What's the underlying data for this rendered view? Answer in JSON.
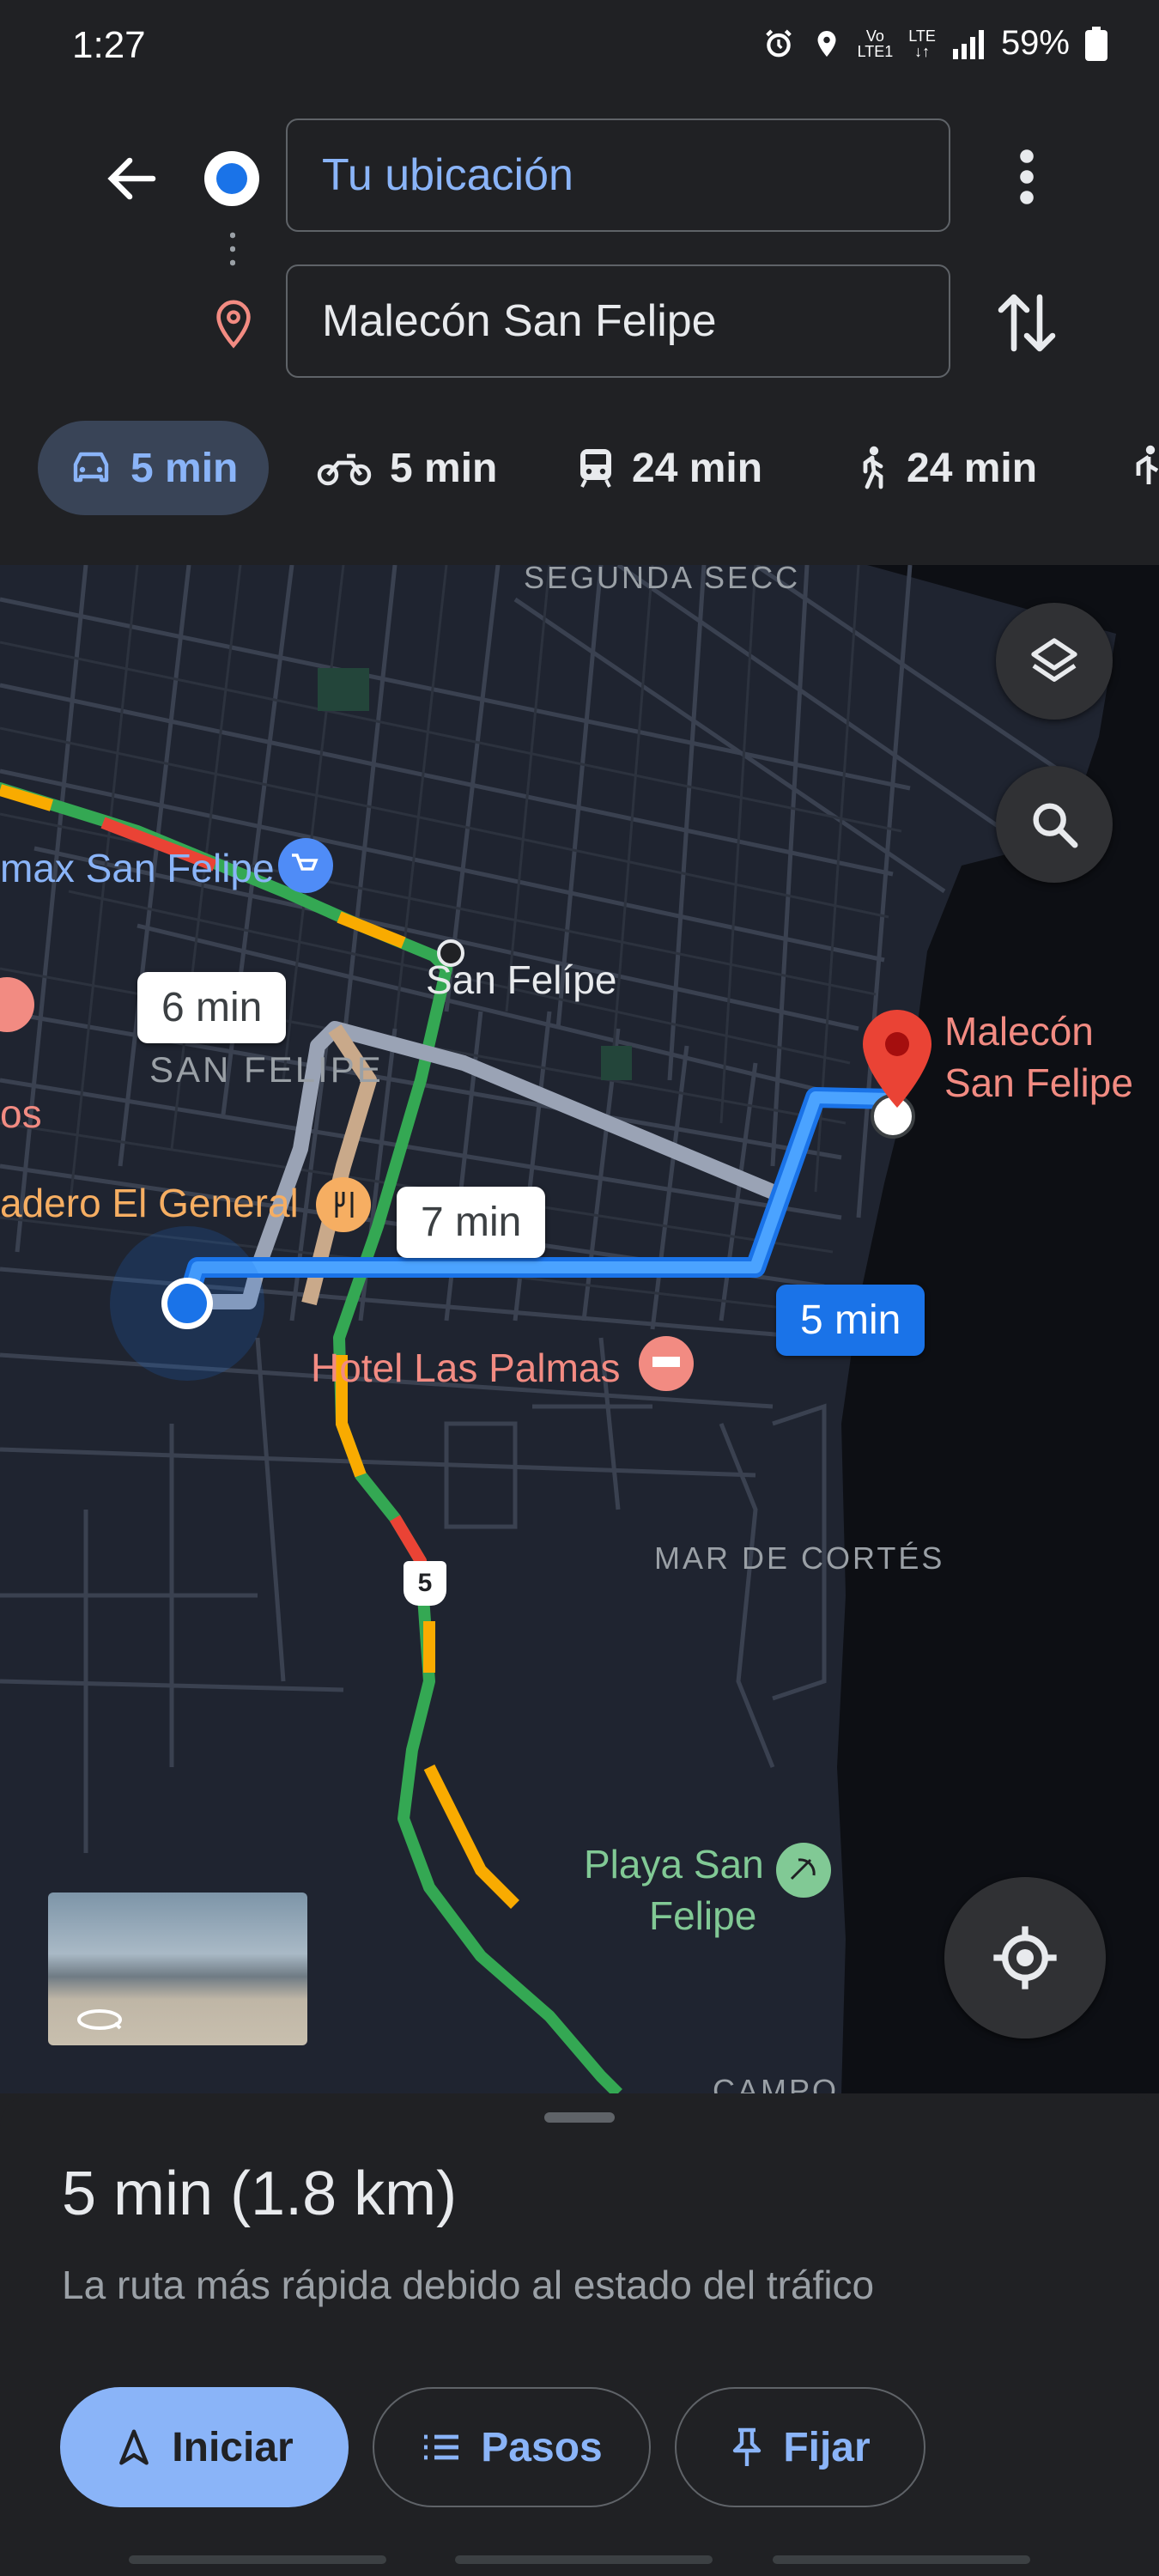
{
  "status_bar": {
    "time": "1:27",
    "network_top": "Vo",
    "network_bottom": "LTE1",
    "lte_label": "LTE",
    "battery": "59%",
    "icons": [
      "alarm-icon",
      "location-icon",
      "signal-icon",
      "battery-icon"
    ]
  },
  "directions": {
    "origin": "Tu ubicación",
    "destination": "Malecón San Felipe"
  },
  "modes": [
    {
      "name": "car",
      "time": "5 min",
      "selected": true
    },
    {
      "name": "motorcycle",
      "time": "5 min",
      "selected": false
    },
    {
      "name": "transit",
      "time": "24 min",
      "selected": false
    },
    {
      "name": "walk",
      "time": "24 min",
      "selected": false
    }
  ],
  "map": {
    "labels": {
      "segunda": "SEGUNDA SECC",
      "walmart": "max San Felipe",
      "san_felipe_city": "San Felípe",
      "san_felipe_area": "SAN FELIPE",
      "os": "os",
      "restaurant": "adero El General",
      "hotel": "Hotel Las Palmas",
      "mar": "MAR DE CORTÉS",
      "playa_line1": "Playa San",
      "playa_line2": "Felipe",
      "dest_line1": "Malecón",
      "dest_line2": "San Felipe",
      "campo": "CAMPO",
      "highway": "5"
    },
    "route_callouts": {
      "alt1": "6 min",
      "alt2": "7 min",
      "selected": "5 min"
    }
  },
  "sheet": {
    "summary": "5 min (1.8 km)",
    "reason": "La ruta más rápida debido al estado del tráfico",
    "buttons": {
      "start": "Iniciar",
      "steps": "Pasos",
      "pin": "Fijar"
    }
  },
  "colors": {
    "accent": "#8ab4f8",
    "route_selected": "#1a73e8",
    "traffic_green": "#34a853",
    "traffic_orange": "#f9ab00",
    "traffic_red": "#ea4335",
    "destination_red": "#ea4335"
  }
}
